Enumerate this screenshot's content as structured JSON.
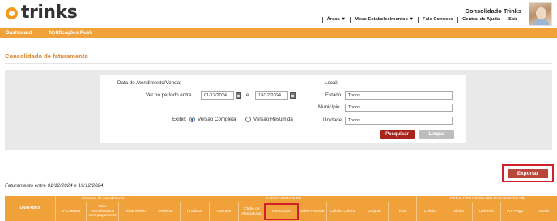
{
  "header": {
    "logo_text": "trinks",
    "establishment_name": "Consolidado Trinks",
    "nav": [
      "Áreas ▼",
      "Meus Estabelecimentos ▼",
      "Fale Conosco",
      "Central de Ajuda",
      "Sair"
    ]
  },
  "menubar": {
    "items": [
      "Dashboard",
      "Notificações Push"
    ]
  },
  "page": {
    "title": "Consolidado de faturamento"
  },
  "filters": {
    "date_section_label": "Data de Atendimento/Venda:",
    "period_label": "Ver no período entre",
    "date_start": "01/12/2024",
    "date_joiner": "e",
    "date_end": "19/12/2024",
    "show_label": "Exibir:",
    "option_complete": "Versão Completa",
    "option_summary": "Versão Resumida",
    "selected_option": "Versão Completa",
    "local_label": "Local:",
    "state_label": "Estado",
    "state_value": "Todos",
    "city_label": "Município",
    "city_value": "Todos",
    "unit_label": "Unidade",
    "unit_value": "Todos",
    "search_button": "Pesquisar",
    "clear_button": "Limpar"
  },
  "export_button": "Exportar",
  "period_text": "Faturamento entre 01/12/2024 e 19/12/2024",
  "table": {
    "group_headers": {
      "units": "UNIDADES",
      "summary": "Resumo de Atendimento",
      "billing": "FATURAMENTO R$",
      "payment": "TOTAL POR FORMA DE PAGAMENTO R$"
    },
    "columns": {
      "clients": "Nº Clientes",
      "visits_paid": "Qtde Atendimentos com pagamento",
      "avg_ticket": "Ticket Médio",
      "services": "Serviços",
      "products": "Produtos",
      "packages": "Pacotes",
      "subscription_club": "Clube de Assinaturas",
      "discounts": "Descontos",
      "gift_card": "Vale Presente",
      "client_credit": "Crédito Cliente",
      "tips": "Gorjeta",
      "total": "Total",
      "credit": "Crédito",
      "debit": "Débito",
      "cash": "Dinheiro",
      "prepaid": "Pré Pago",
      "others": "Outros"
    }
  },
  "colors": {
    "brand_orange": "#f0a13a",
    "title_orange": "#d9822b",
    "search_red": "#a8231a",
    "export_red": "#b8473a",
    "highlight_red": "#d0202a"
  }
}
